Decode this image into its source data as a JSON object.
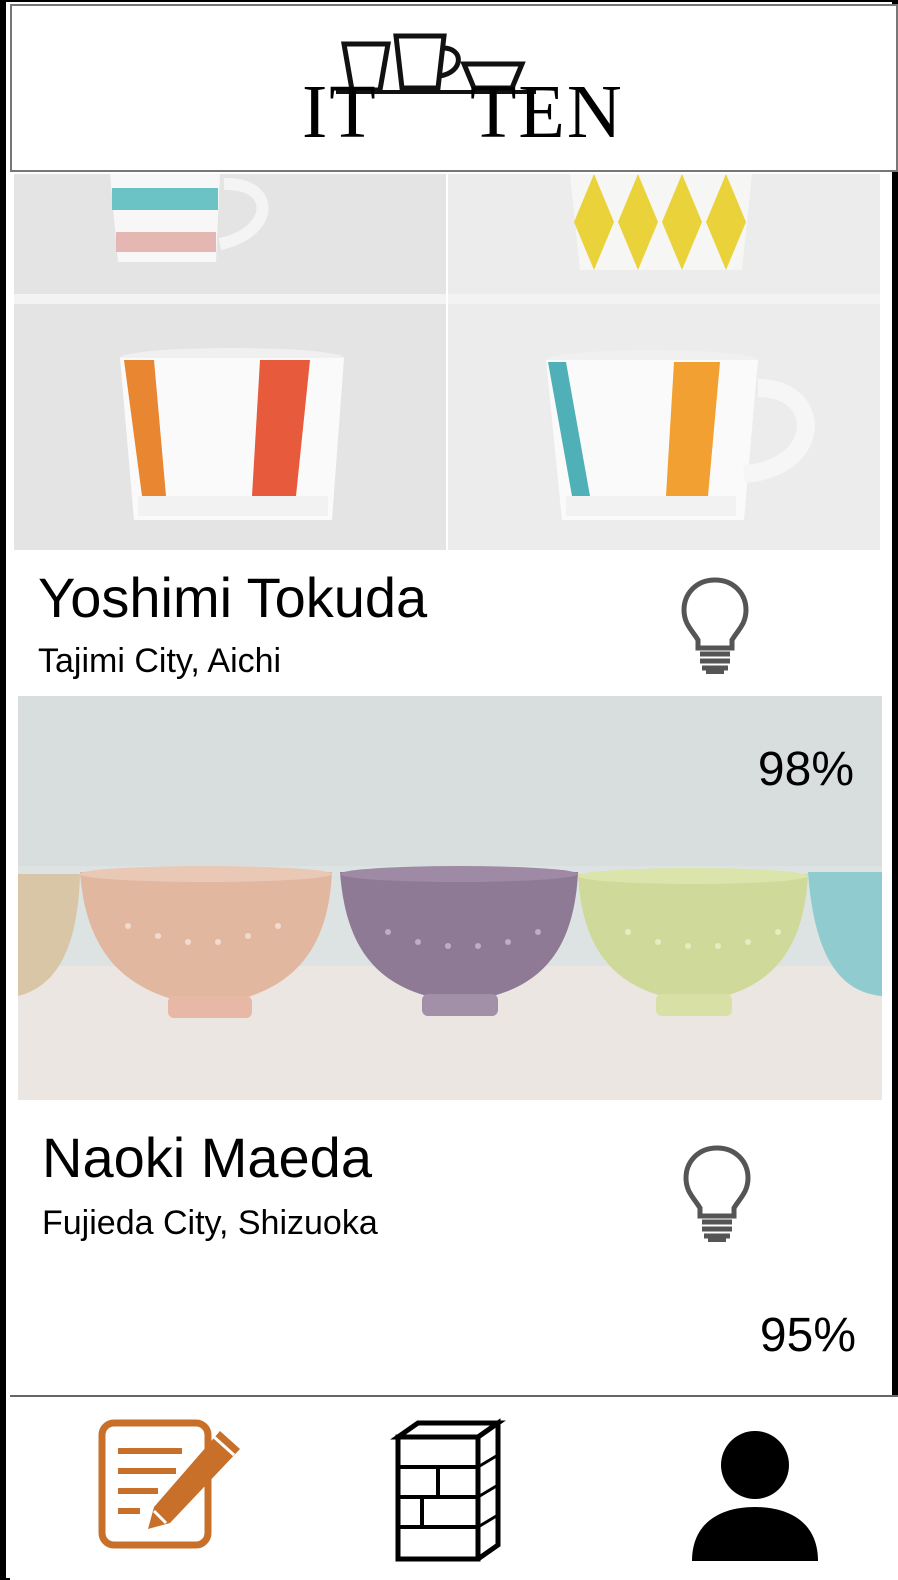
{
  "app": {
    "logo_text_left": "IT",
    "logo_text_right": "TEN"
  },
  "feed": [
    {
      "name": "Yoshimi Tokuda",
      "location": "Tajimi City, Aichi",
      "match": "98%",
      "icon": "lightbulb-icon"
    },
    {
      "name": "Naoki Maeda",
      "location": "Fujieda City, Shizuoka",
      "match": "95%",
      "icon": "lightbulb-icon"
    }
  ],
  "tabbar": {
    "items": [
      {
        "icon": "edit-document-icon",
        "color": "#c8702a"
      },
      {
        "icon": "shelf-icon",
        "color": "#000000"
      },
      {
        "icon": "user-profile-icon",
        "color": "#000000"
      }
    ]
  }
}
